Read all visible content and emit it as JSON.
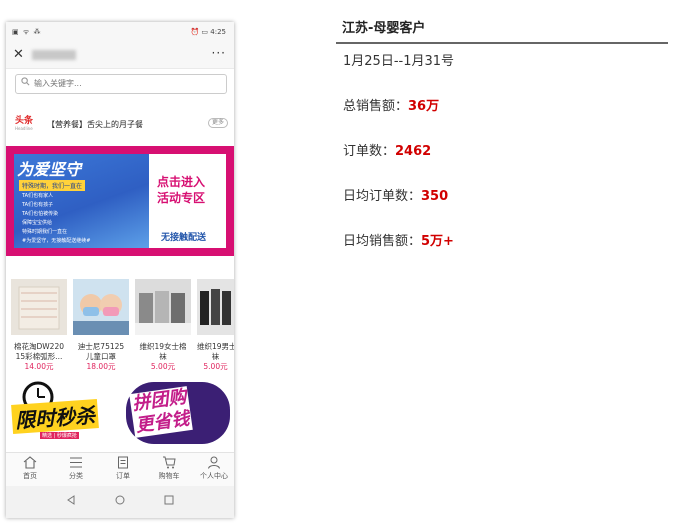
{
  "phone": {
    "status": {
      "time": "4:25",
      "left_icons": "▣ ᯤ ⁂"
    },
    "search": {
      "placeholder": "输入关键字..."
    },
    "headline": {
      "logo": "头条",
      "logo_sub": "Headline",
      "text": "【营养餐】舌尖上的月子餐",
      "more": "更多"
    },
    "banner": {
      "title": "为爱坚守",
      "tag": "特殊时期，我们一直在",
      "lines": [
        "TA们也有家人",
        "TA们也有孩子",
        "TA们也怕被传染",
        "保障宝宝供给",
        "特殊时期我们一直在",
        "#为爱坚守，无接触配送继续#"
      ],
      "cta": "点击进入\n活动专区",
      "delivery": "无接触配送"
    },
    "products": [
      {
        "name1": "棉花淘DW220",
        "name2": "15彩棉弧形...",
        "price": "14.00元"
      },
      {
        "name1": "迪士尼75125",
        "name2": "儿童口罩",
        "price": "18.00元"
      },
      {
        "name1": "维织19女士棉",
        "name2": "袜",
        "price": "5.00元"
      },
      {
        "name1": "维织19男士",
        "name2": "袜",
        "price": "5.00元"
      }
    ],
    "promos": {
      "left": "限时秒杀",
      "left_tag": "精选 | 秒爆疯抢",
      "right": "拼团购\n更省钱"
    },
    "tabs": [
      {
        "label": "首页",
        "icon": "home-icon"
      },
      {
        "label": "分类",
        "icon": "list-icon"
      },
      {
        "label": "订单",
        "icon": "order-icon"
      },
      {
        "label": "购物车",
        "icon": "cart-icon"
      },
      {
        "label": "个人中心",
        "icon": "user-icon"
      }
    ]
  },
  "panel": {
    "title": "江苏-母婴客户",
    "date_range": "1月25日--1月31号",
    "stats": [
      {
        "label": "总销售额：",
        "value": "36万"
      },
      {
        "label": "订单数：",
        "value": "2462"
      },
      {
        "label": "日均订单数：",
        "value": "350"
      },
      {
        "label": "日均销售额：",
        "value": "5万+"
      }
    ],
    "colors": {
      "highlight": "#d10000",
      "banner": "#d70f72",
      "price": "#e0245e"
    }
  }
}
